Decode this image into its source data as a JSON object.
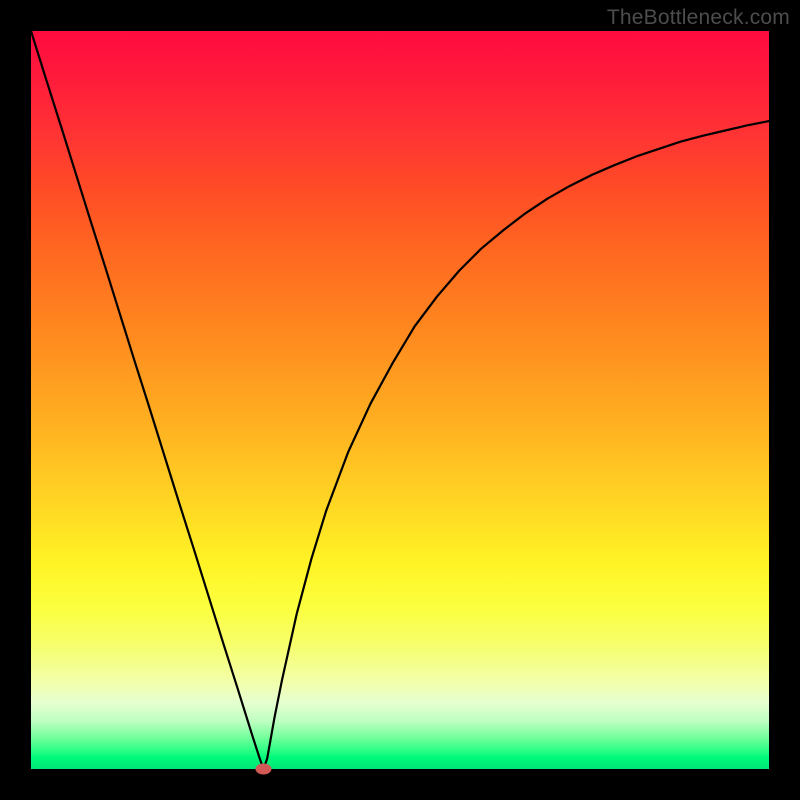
{
  "watermark": "TheBottleneck.com",
  "chart_data": {
    "type": "line",
    "title": "",
    "xlabel": "",
    "ylabel": "",
    "xlim": [
      0,
      100
    ],
    "ylim": [
      0,
      100
    ],
    "grid": false,
    "series": [
      {
        "name": "curve",
        "x": [
          0,
          2,
          4,
          6,
          8,
          10,
          12,
          14,
          16,
          18,
          20,
          22,
          24,
          26,
          28,
          29,
          30,
          31,
          31.5,
          32,
          33,
          34,
          36,
          38,
          40,
          43,
          46,
          49,
          52,
          55,
          58,
          61,
          64,
          67,
          70,
          73,
          76,
          79,
          82,
          85,
          88,
          91,
          94,
          97,
          100
        ],
        "y": [
          100,
          93.6,
          87.3,
          80.9,
          74.5,
          68.2,
          61.8,
          55.4,
          49.1,
          42.7,
          36.3,
          30,
          23.6,
          17.2,
          10.9,
          7.7,
          4.5,
          1.4,
          0,
          1.4,
          7,
          12,
          21,
          28.5,
          35,
          43,
          49.5,
          55,
          60,
          64,
          67.5,
          70.5,
          73,
          75.3,
          77.3,
          79,
          80.5,
          81.8,
          83,
          84,
          85,
          85.8,
          86.5,
          87.2,
          87.8
        ]
      }
    ],
    "marker": {
      "x": 31.5,
      "y": 0,
      "color": "#d25a56"
    },
    "gradient_stops": [
      {
        "pos": 0.0,
        "color": "#ff0b3f"
      },
      {
        "pos": 0.3,
        "color": "#ff6820"
      },
      {
        "pos": 0.64,
        "color": "#ffd624"
      },
      {
        "pos": 0.88,
        "color": "#f3ffa8"
      },
      {
        "pos": 1.0,
        "color": "#00e676"
      }
    ]
  }
}
